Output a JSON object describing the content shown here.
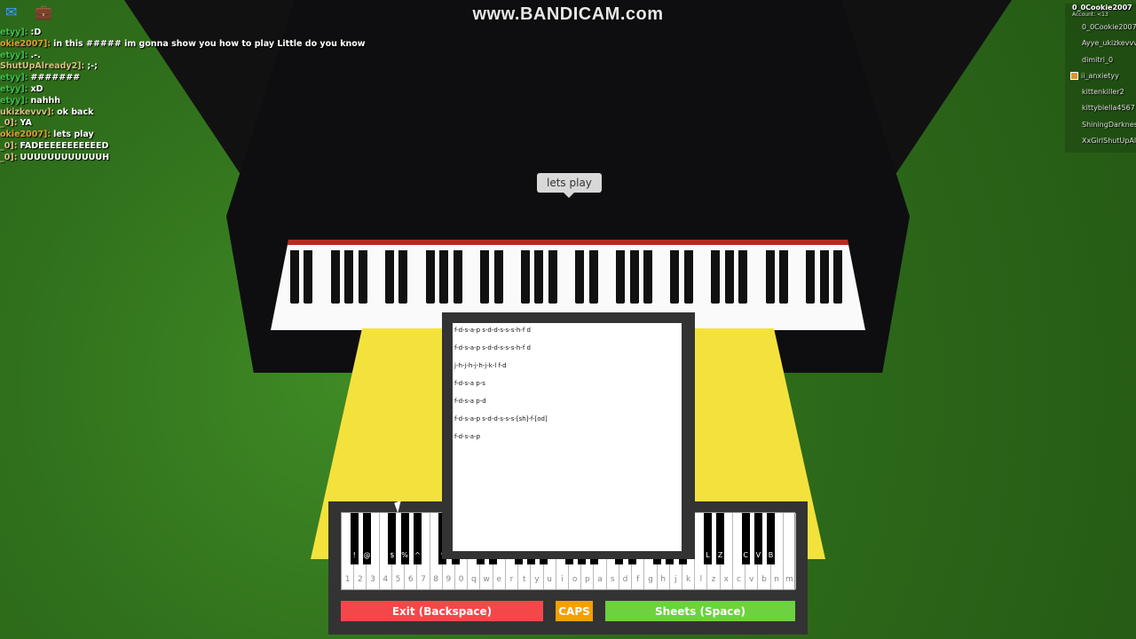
{
  "watermark": "www.BANDICAM.com",
  "icons": {
    "chat": "chat-bubble-icon",
    "backpack": "backpack-icon"
  },
  "chat": [
    {
      "name": "etyy]:",
      "msg": ":D",
      "color": "#3fbf4a"
    },
    {
      "name": "okie2007]:",
      "msg": "in this ##### im gonna show you how to play Little do you know",
      "color": "#e0a030"
    },
    {
      "name": "etyy]:",
      "msg": ".-.",
      "color": "#3fbf4a"
    },
    {
      "name": "ShutUpAlready2]:",
      "msg": ";-;",
      "color": "#d8c080"
    },
    {
      "name": "etyy]:",
      "msg": "#######",
      "color": "#3fbf4a"
    },
    {
      "name": "etyy]:",
      "msg": "xD",
      "color": "#3fbf4a"
    },
    {
      "name": "etyy]:",
      "msg": "nahhh",
      "color": "#3fbf4a"
    },
    {
      "name": "ukizkevvv]:",
      "msg": "ok back",
      "color": "#d8c080"
    },
    {
      "name": "_0]:",
      "msg": "YA",
      "color": "#d8c080"
    },
    {
      "name": "okie2007]:",
      "msg": "lets play",
      "color": "#e0a030"
    },
    {
      "name": "_0]:",
      "msg": "FADEEEEEEEEEEED",
      "color": "#d8c080"
    },
    {
      "name": "_0]:",
      "msg": "UUUUUUUUUUUUH",
      "color": "#d8c080"
    }
  ],
  "players": {
    "me": "0_0Cookie2007",
    "account": "Account: <13",
    "list": [
      "0_0Cookie2007",
      "Ayye_ukizkevvv",
      "dimitri_0",
      "ii_anxietyy",
      "kittenkiller2",
      "kittybiella4567",
      "ShiningDarknes",
      "XxGirlShutUpAlrea"
    ],
    "badge_index": 3
  },
  "bubble": "lets play",
  "sheet": [
    "f-d-s-a-p s-d-d-s-s-s-h-f d",
    "f-d-s-a-p s-d-d-s-s-s-h-f d",
    "j-h-j-h-j-h-j-k-l f-d",
    "f-d-s-a p-s",
    "f-d-s-a p-d",
    "f-d-s-a-p s-d-d-s-s-s-[sh]-f-[od]",
    "f-d-s-a-p"
  ],
  "keyboard": {
    "white": [
      "1",
      "2",
      "3",
      "4",
      "5",
      "6",
      "7",
      "8",
      "9",
      "0",
      "q",
      "w",
      "e",
      "r",
      "t",
      "y",
      "u",
      "i",
      "o",
      "p",
      "a",
      "s",
      "d",
      "f",
      "g",
      "h",
      "j",
      "k",
      "l",
      "z",
      "x",
      "c",
      "v",
      "b",
      "n",
      "m"
    ],
    "black": [
      [
        0,
        "!"
      ],
      [
        1,
        "@"
      ],
      [
        3,
        "$"
      ],
      [
        4,
        "%"
      ],
      [
        5,
        "^"
      ],
      [
        7,
        "*"
      ],
      [
        8,
        "("
      ],
      [
        10,
        "Q"
      ],
      [
        11,
        "W"
      ],
      [
        13,
        "E"
      ],
      [
        14,
        "T"
      ],
      [
        15,
        "Y"
      ],
      [
        17,
        "I"
      ],
      [
        18,
        "O"
      ],
      [
        19,
        "P"
      ],
      [
        21,
        "S"
      ],
      [
        22,
        "D"
      ],
      [
        24,
        "G"
      ],
      [
        25,
        "H"
      ],
      [
        26,
        "J"
      ],
      [
        28,
        "L"
      ],
      [
        29,
        "Z"
      ],
      [
        31,
        "C"
      ],
      [
        32,
        "V"
      ],
      [
        33,
        "B"
      ]
    ]
  },
  "buttons": {
    "exit": "Exit (Backspace)",
    "caps": "CAPS",
    "sheets": "Sheets (Space)"
  },
  "colors": {
    "exit": "#f4474a",
    "caps": "#f5a000",
    "sheets": "#6cd23e"
  }
}
